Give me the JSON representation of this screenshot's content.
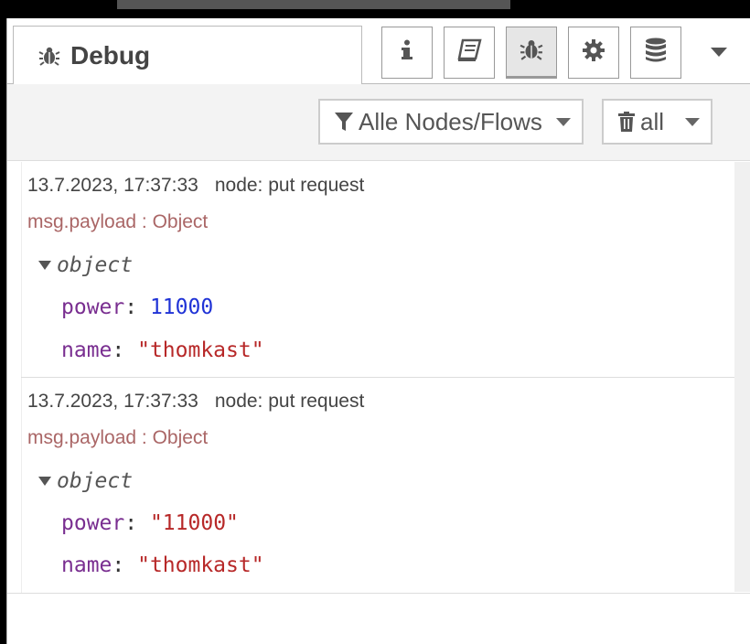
{
  "tab": {
    "title": "Debug",
    "icon": "bug-icon"
  },
  "header_buttons": [
    {
      "name": "info-button",
      "icon": "info-icon"
    },
    {
      "name": "help-button",
      "icon": "book-icon"
    },
    {
      "name": "debug-button",
      "icon": "bug-icon",
      "selected": true
    },
    {
      "name": "config-button",
      "icon": "gear-icon"
    },
    {
      "name": "context-button",
      "icon": "database-icon"
    }
  ],
  "toolbar": {
    "filter_label": "Alle Nodes/Flows",
    "clear_label": "all"
  },
  "messages": [
    {
      "timestamp": "13.7.2023, 17:37:33",
      "node": "node: put request",
      "topic": "msg.payload : Object",
      "type": "object",
      "props": [
        {
          "key": "power",
          "value": "11000",
          "kind": "number"
        },
        {
          "key": "name",
          "value": "\"thomkast\"",
          "kind": "string"
        }
      ]
    },
    {
      "timestamp": "13.7.2023, 17:37:33",
      "node": "node: put request",
      "topic": "msg.payload : Object",
      "type": "object",
      "props": [
        {
          "key": "power",
          "value": "\"11000\"",
          "kind": "string"
        },
        {
          "key": "name",
          "value": "\"thomkast\"",
          "kind": "string"
        }
      ]
    }
  ],
  "colors": {
    "key": "#792e90",
    "number": "#2033d6",
    "string": "#b72828",
    "topic": "#aa6666"
  }
}
